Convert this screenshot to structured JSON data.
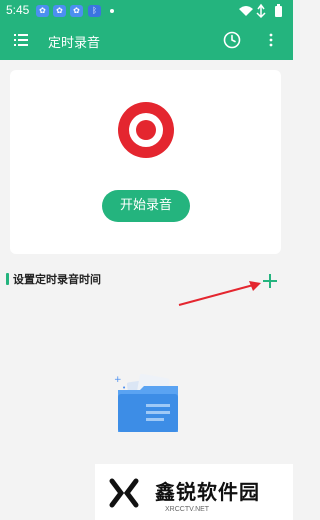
{
  "status_bar": {
    "time": "5:45",
    "badges": [
      "b1",
      "b2",
      "b3",
      "b4"
    ]
  },
  "app_bar": {
    "title": "定时录音",
    "menu_icon": "list-icon",
    "clock_icon": "clock-icon",
    "more_icon": "more-vert-icon"
  },
  "recorder": {
    "start_label": "开始录音"
  },
  "schedule": {
    "section_title": "设置定时录音时间"
  },
  "watermark": {
    "brand": "鑫锐软件园",
    "domain": "XRCCTV.NET"
  },
  "colors": {
    "accent": "#24b47e",
    "record_red": "#e4262f"
  }
}
